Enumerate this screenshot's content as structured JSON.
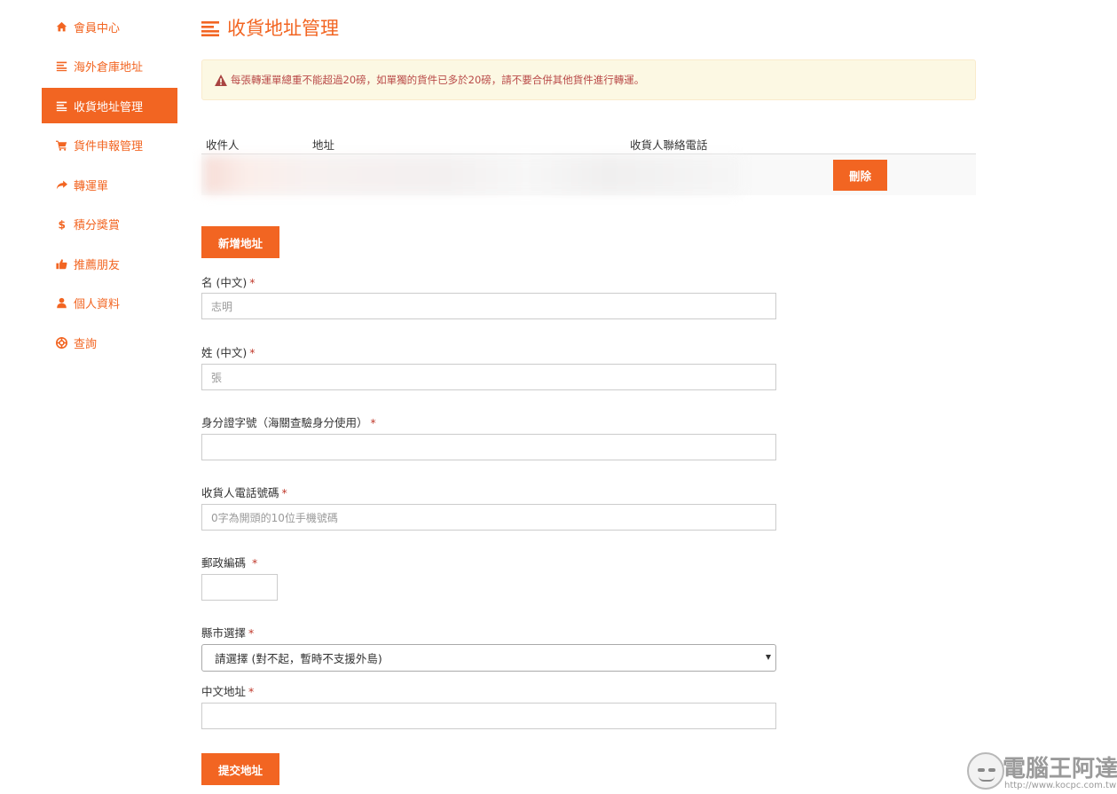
{
  "sidebar": {
    "items": [
      {
        "label": "會員中心",
        "icon": "home-icon"
      },
      {
        "label": "海外倉庫地址",
        "icon": "list-icon"
      },
      {
        "label": "收貨地址管理",
        "icon": "list-icon",
        "active": true
      },
      {
        "label": "貨件申報管理",
        "icon": "cart-icon"
      },
      {
        "label": "轉運單",
        "icon": "share-arrow-icon"
      },
      {
        "label": "積分獎賞",
        "icon": "dollar-icon"
      },
      {
        "label": "推薦朋友",
        "icon": "thumbs-up-icon"
      },
      {
        "label": "個人資料",
        "icon": "user-icon"
      },
      {
        "label": "查詢",
        "icon": "lifebuoy-icon"
      }
    ]
  },
  "page": {
    "title": "收貨地址管理",
    "alert": "每張轉運單總重不能超過20磅，如單獨的貨件已多於20磅，請不要合併其他貨件進行轉運。"
  },
  "table": {
    "headers": [
      "收件人",
      "地址",
      "收貨人聯絡電話"
    ],
    "row_delete_label": "刪除"
  },
  "buttons": {
    "add_address": "新增地址",
    "submit_address": "提交地址"
  },
  "form": {
    "first_name": {
      "label": "名 (中文)",
      "required": "*",
      "placeholder": "志明"
    },
    "last_name": {
      "label": "姓 (中文)",
      "required": "*",
      "placeholder": "張"
    },
    "id_number": {
      "label": "身分證字號（海關查驗身分使用）",
      "required": "*",
      "placeholder": ""
    },
    "phone": {
      "label": "收貨人電話號碼",
      "required": "*",
      "placeholder": "0字為開頭的10位手機號碼"
    },
    "postal_code": {
      "label": "郵政編碼",
      "required": "*",
      "placeholder": ""
    },
    "city": {
      "label": "縣市選擇",
      "required": "*",
      "selected": "請選擇 (對不起，暫時不支援外島)"
    },
    "address": {
      "label": "中文地址",
      "required": "*",
      "placeholder": ""
    }
  },
  "watermark": {
    "title": "電腦王阿達",
    "url": "http://www.kocpc.com.tw"
  },
  "colors": {
    "accent": "#f26522",
    "alert_bg": "#fcf8e3",
    "alert_text": "#b94a48"
  }
}
